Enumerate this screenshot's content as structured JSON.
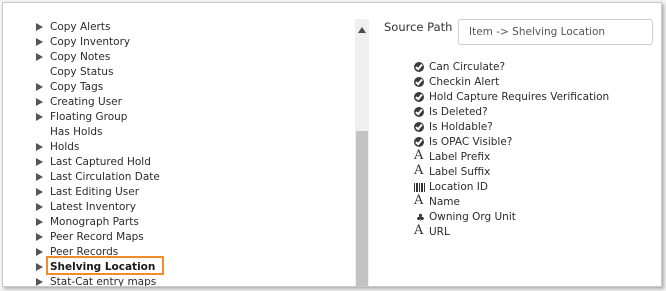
{
  "tree": {
    "items": [
      {
        "label": "Copy Alerts",
        "expandable": true
      },
      {
        "label": "Copy Inventory",
        "expandable": true
      },
      {
        "label": "Copy Notes",
        "expandable": true
      },
      {
        "label": "Copy Status",
        "expandable": false
      },
      {
        "label": "Copy Tags",
        "expandable": true
      },
      {
        "label": "Creating User",
        "expandable": true
      },
      {
        "label": "Floating Group",
        "expandable": true
      },
      {
        "label": "Has Holds",
        "expandable": false
      },
      {
        "label": "Holds",
        "expandable": true
      },
      {
        "label": "Last Captured Hold",
        "expandable": true
      },
      {
        "label": "Last Circulation Date",
        "expandable": true
      },
      {
        "label": "Last Editing User",
        "expandable": true
      },
      {
        "label": "Latest Inventory",
        "expandable": true
      },
      {
        "label": "Monograph Parts",
        "expandable": true
      },
      {
        "label": "Peer Record Maps",
        "expandable": true
      },
      {
        "label": "Peer Records",
        "expandable": true
      },
      {
        "label": "Shelving Location",
        "expandable": true,
        "selected": true
      },
      {
        "label": "Stat-Cat entry maps",
        "expandable": true
      }
    ]
  },
  "source_path": {
    "label": "Source Path",
    "value": "Item -> Shelving Location"
  },
  "fields": [
    {
      "label": "Can Circulate?",
      "icon": "bool-check-icon"
    },
    {
      "label": "Checkin Alert",
      "icon": "bool-check-icon"
    },
    {
      "label": "Hold Capture Requires Verification",
      "icon": "bool-check-icon"
    },
    {
      "label": "Is Deleted?",
      "icon": "bool-check-icon"
    },
    {
      "label": "Is Holdable?",
      "icon": "bool-check-icon"
    },
    {
      "label": "Is OPAC Visible?",
      "icon": "bool-check-icon"
    },
    {
      "label": "Label Prefix",
      "icon": "text-icon"
    },
    {
      "label": "Label Suffix",
      "icon": "text-icon"
    },
    {
      "label": "Location ID",
      "icon": "id-barcode-icon"
    },
    {
      "label": "Name",
      "icon": "text-icon"
    },
    {
      "label": "Owning Org Unit",
      "icon": "org-tree-icon"
    },
    {
      "label": "URL",
      "icon": "text-icon"
    }
  ]
}
